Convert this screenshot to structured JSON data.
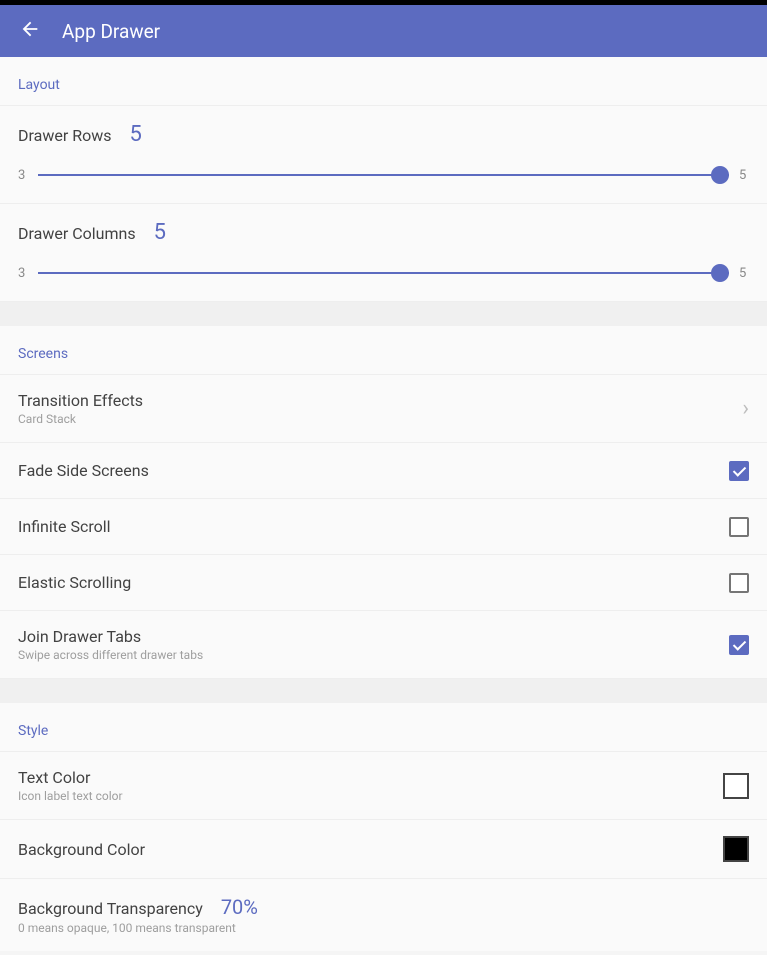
{
  "header": {
    "title": "App Drawer"
  },
  "layout": {
    "section_label": "Layout",
    "drawer_rows": {
      "label": "Drawer Rows",
      "value": "5",
      "min": "3",
      "max": "5"
    },
    "drawer_columns": {
      "label": "Drawer Columns",
      "value": "5",
      "min": "3",
      "max": "5"
    }
  },
  "screens": {
    "section_label": "Screens",
    "transition_effects": {
      "label": "Transition Effects",
      "value": "Card Stack"
    },
    "fade_side_screens": {
      "label": "Fade Side Screens",
      "checked": true
    },
    "infinite_scroll": {
      "label": "Infinite Scroll",
      "checked": false
    },
    "elastic_scrolling": {
      "label": "Elastic Scrolling",
      "checked": false
    },
    "join_drawer_tabs": {
      "label": "Join Drawer Tabs",
      "sub": "Swipe across different drawer tabs",
      "checked": true
    }
  },
  "style": {
    "section_label": "Style",
    "text_color": {
      "label": "Text Color",
      "sub": "Icon label text color",
      "color": "#ffffff"
    },
    "background_color": {
      "label": "Background Color",
      "color": "#000000"
    },
    "background_transparency": {
      "label": "Background Transparency",
      "value": "70%",
      "sub": "0 means opaque, 100 means transparent"
    }
  }
}
